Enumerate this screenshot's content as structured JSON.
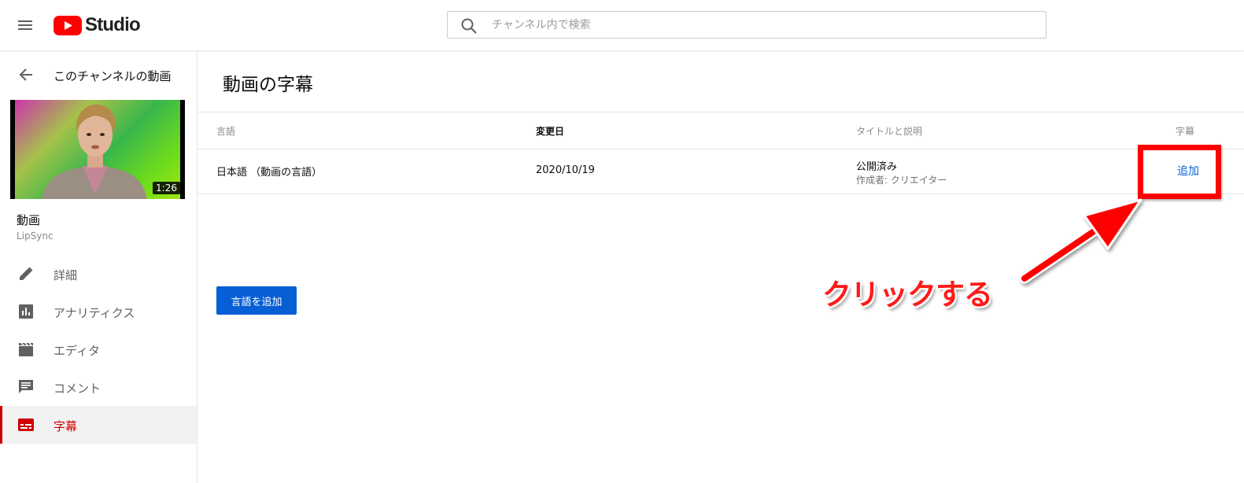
{
  "header": {
    "logo_text": "Studio",
    "search": {
      "placeholder": "チャンネル内で検索"
    },
    "icons": [
      "menu-icon",
      "youtube-logo-icon",
      "search-icon"
    ]
  },
  "sidebar": {
    "back_label": "このチャンネルの動画",
    "video": {
      "duration": "1:26",
      "title": "動画",
      "channel": "LipSync"
    },
    "items": [
      {
        "label": "詳細",
        "icon": "pencil-icon",
        "active": false
      },
      {
        "label": "アナリティクス",
        "icon": "analytics-icon",
        "active": false
      },
      {
        "label": "エディタ",
        "icon": "clapperboard-icon",
        "active": false
      },
      {
        "label": "コメント",
        "icon": "comment-icon",
        "active": false
      },
      {
        "label": "字幕",
        "icon": "subtitles-icon",
        "active": true
      }
    ]
  },
  "main": {
    "title": "動画の字幕",
    "columns": {
      "language": "言語",
      "modified": "変更日",
      "title_desc": "タイトルと説明",
      "subtitles": "字幕"
    },
    "rows": [
      {
        "language": "日本語 （動画の言語）",
        "modified": "2020/10/19",
        "status": "公開済み",
        "author": "作成者: クリエイター",
        "action": "追加"
      }
    ],
    "add_language_button": "言語を追加"
  },
  "annotation": {
    "text": "クリックする"
  },
  "colors": {
    "accent_red": "#cc0000",
    "link_blue": "#065fd4",
    "annotation_red": "#ff0000"
  }
}
